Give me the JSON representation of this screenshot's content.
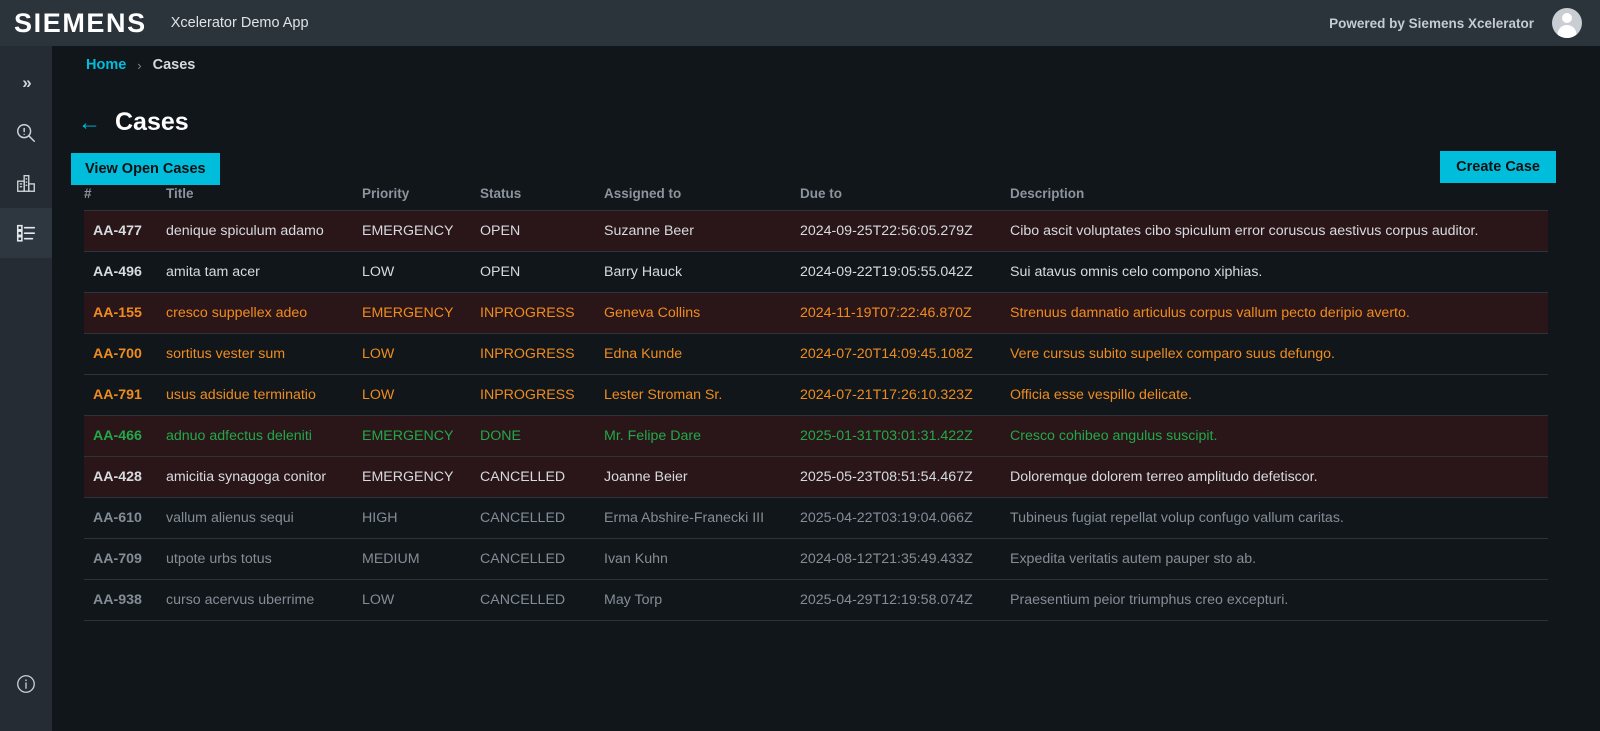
{
  "topbar": {
    "logo": "SIEMENS",
    "app_title": "Xcelerator Demo App",
    "powered_by": "Powered by Siemens Xcelerator",
    "avatar_icon": "user-avatar-icon"
  },
  "sidebar": {
    "expand_icon": "chevron-double-right-icon",
    "items": [
      {
        "icon": "magnifier-alert-icon",
        "active": false
      },
      {
        "icon": "factory-building-icon",
        "active": false
      },
      {
        "icon": "list-checklist-icon",
        "active": true
      }
    ],
    "bottom_icon": "info-circle-icon"
  },
  "breadcrumb": {
    "home": "Home",
    "separator": "›",
    "current": "Cases"
  },
  "page": {
    "back_icon": "arrow-left-icon",
    "title": "Cases",
    "view_open_label": "View Open Cases",
    "create_label": "Create Case"
  },
  "colors": {
    "accent": "#00bedb",
    "topbar_bg": "#2b333b",
    "sidebar_bg": "#252c34",
    "page_bg": "#11161b",
    "emergency_row_bg": "#2a1618",
    "inprogress_text": "#f08c1e",
    "done_text": "#22a84a",
    "dim_text": "#848d96"
  },
  "table": {
    "columns": [
      "#",
      "Title",
      "Priority",
      "Status",
      "Assigned to",
      "Due to",
      "Description"
    ],
    "rows": [
      {
        "num": "AA-477",
        "title": "denique spiculum adamo",
        "priority": "EMERGENCY",
        "status": "OPEN",
        "assigned": "Suzanne Beer",
        "due": "2024-09-25T22:56:05.279Z",
        "description": "Cibo ascit voluptates cibo spiculum error coruscus aestivus corpus auditor.",
        "state": "open",
        "emergency": true,
        "dim": false
      },
      {
        "num": "AA-496",
        "title": "amita tam acer",
        "priority": "LOW",
        "status": "OPEN",
        "assigned": "Barry Hauck",
        "due": "2024-09-22T19:05:55.042Z",
        "description": "Sui atavus omnis celo compono xiphias.",
        "state": "open",
        "emergency": false,
        "dim": false
      },
      {
        "num": "AA-155",
        "title": "cresco suppellex adeo",
        "priority": "EMERGENCY",
        "status": "INPROGRESS",
        "assigned": "Geneva Collins",
        "due": "2024-11-19T07:22:46.870Z",
        "description": "Strenuus damnatio articulus corpus vallum pecto deripio averto.",
        "state": "inprogress",
        "emergency": true,
        "dim": false
      },
      {
        "num": "AA-700",
        "title": "sortitus vester sum",
        "priority": "LOW",
        "status": "INPROGRESS",
        "assigned": "Edna Kunde",
        "due": "2024-07-20T14:09:45.108Z",
        "description": "Vere cursus subito supellex comparo suus defungo.",
        "state": "inprogress",
        "emergency": false,
        "dim": false
      },
      {
        "num": "AA-791",
        "title": "usus adsidue terminatio",
        "priority": "LOW",
        "status": "INPROGRESS",
        "assigned": "Lester Stroman Sr.",
        "due": "2024-07-21T17:26:10.323Z",
        "description": "Officia esse vespillo delicate.",
        "state": "inprogress",
        "emergency": false,
        "dim": false
      },
      {
        "num": "AA-466",
        "title": "adnuo adfectus deleniti",
        "priority": "EMERGENCY",
        "status": "DONE",
        "assigned": "Mr. Felipe Dare",
        "due": "2025-01-31T03:01:31.422Z",
        "description": "Cresco cohibeo angulus suscipit.",
        "state": "done",
        "emergency": true,
        "dim": false
      },
      {
        "num": "AA-428",
        "title": "amicitia synagoga conitor",
        "priority": "EMERGENCY",
        "status": "CANCELLED",
        "assigned": "Joanne Beier",
        "due": "2025-05-23T08:51:54.467Z",
        "description": "Doloremque dolorem terreo amplitudo defetiscor.",
        "state": "cancelled",
        "emergency": true,
        "dim": false
      },
      {
        "num": "AA-610",
        "title": "vallum alienus sequi",
        "priority": "HIGH",
        "status": "CANCELLED",
        "assigned": "Erma Abshire-Franecki III",
        "due": "2025-04-22T03:19:04.066Z",
        "description": "Tubineus fugiat repellat volup confugo vallum caritas.",
        "state": "cancelled",
        "emergency": false,
        "dim": true
      },
      {
        "num": "AA-709",
        "title": "utpote urbs totus",
        "priority": "MEDIUM",
        "status": "CANCELLED",
        "assigned": "Ivan Kuhn",
        "due": "2024-08-12T21:35:49.433Z",
        "description": "Expedita veritatis autem pauper sto ab.",
        "state": "cancelled",
        "emergency": false,
        "dim": true
      },
      {
        "num": "AA-938",
        "title": "curso acervus uberrime",
        "priority": "LOW",
        "status": "CANCELLED",
        "assigned": "May Torp",
        "due": "2025-04-29T12:19:58.074Z",
        "description": "Praesentium peior triumphus creo excepturi.",
        "state": "cancelled",
        "emergency": false,
        "dim": true
      }
    ]
  }
}
